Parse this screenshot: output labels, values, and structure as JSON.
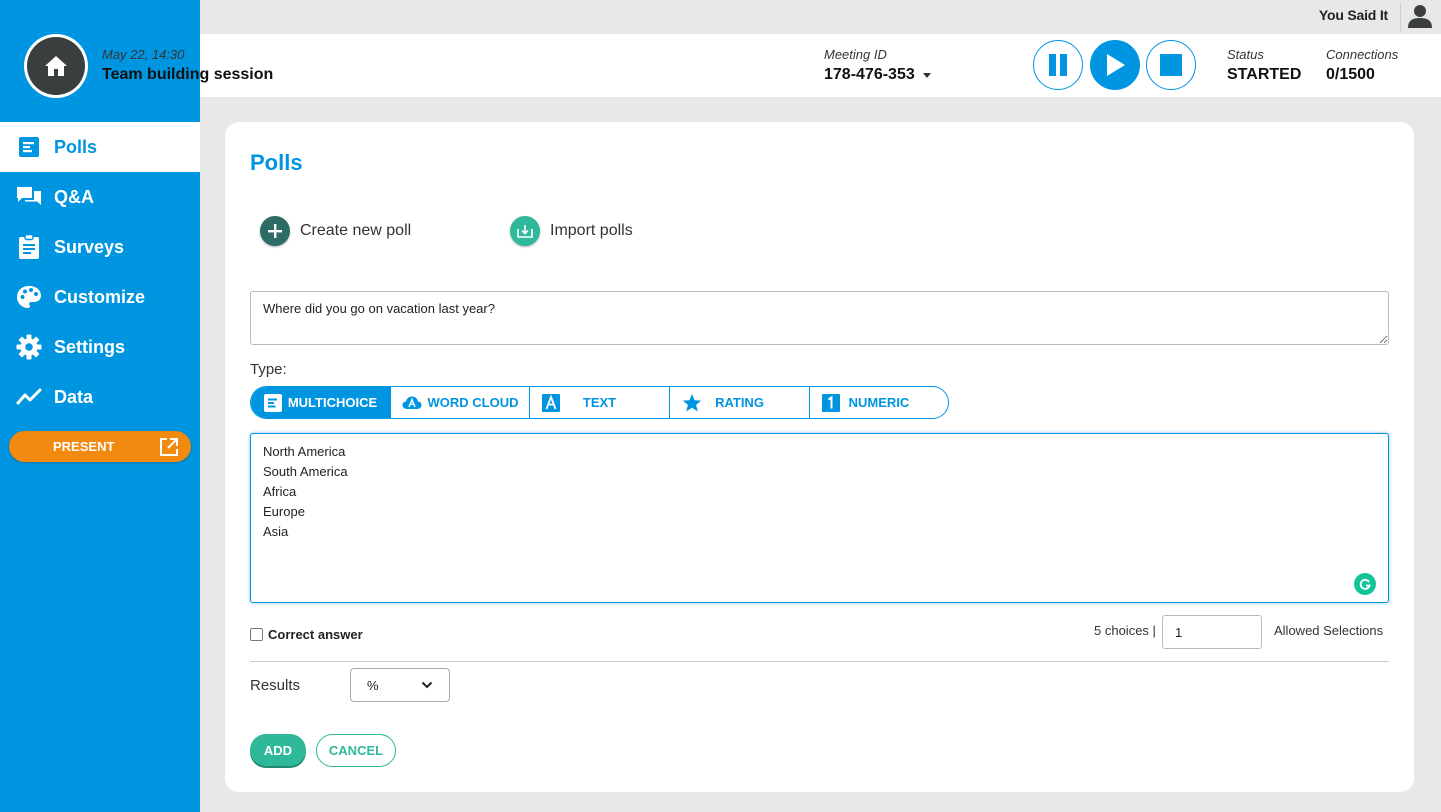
{
  "user": {
    "name": "You Said It"
  },
  "session": {
    "date": "May 22, 14:30",
    "title": "Team building session"
  },
  "meeting": {
    "label": "Meeting ID",
    "id": "178-476-353"
  },
  "status": {
    "label": "Status",
    "value": "STARTED"
  },
  "connections": {
    "label": "Connections",
    "value": "0/1500"
  },
  "sidebar": {
    "items": [
      {
        "label": "Polls",
        "icon": "polls-icon",
        "active": true
      },
      {
        "label": "Q&A",
        "icon": "chat-icon",
        "active": false
      },
      {
        "label": "Surveys",
        "icon": "clipboard-icon",
        "active": false
      },
      {
        "label": "Customize",
        "icon": "palette-icon",
        "active": false
      },
      {
        "label": "Settings",
        "icon": "gear-icon",
        "active": false
      },
      {
        "label": "Data",
        "icon": "trend-icon",
        "active": false
      }
    ],
    "present_label": "PRESENT"
  },
  "main": {
    "title": "Polls",
    "create_label": "Create new poll",
    "import_label": "Import polls",
    "question": "Where did you go on vacation last year?",
    "type_label": "Type:",
    "types": [
      {
        "label": "MULTICHOICE",
        "active": true
      },
      {
        "label": "WORD CLOUD",
        "active": false
      },
      {
        "label": "TEXT",
        "active": false
      },
      {
        "label": "RATING",
        "active": false
      },
      {
        "label": "NUMERIC",
        "active": false
      }
    ],
    "answers": [
      "North America",
      "South America",
      "Africa",
      "Europe",
      "Asia"
    ],
    "correct_label": "Correct answer",
    "choices_text": "5 choices |",
    "allowed_value": "1",
    "allowed_label": "Allowed Selections",
    "results_label": "Results",
    "results_value": "%",
    "add_label": "ADD",
    "cancel_label": "CANCEL"
  },
  "colors": {
    "brand_blue": "#0095e0",
    "present_orange": "#f28a0f",
    "teal": "#2fb89a",
    "dark_teal": "#2d6b65"
  }
}
